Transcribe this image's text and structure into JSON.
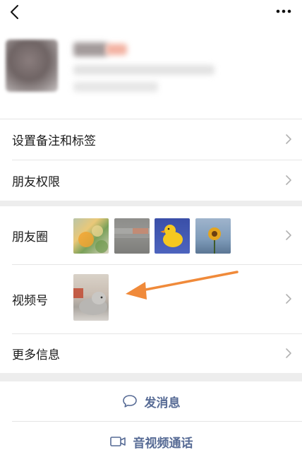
{
  "header": {
    "back_icon": "chevron-left-icon",
    "more_icon": "more-dots-icon"
  },
  "menu": {
    "remark_label": "设置备注和标签",
    "permission_label": "朋友权限",
    "moments_label": "朋友圈",
    "channels_label": "视频号",
    "more_info_label": "更多信息"
  },
  "actions": {
    "message_label": "发消息",
    "call_label": "音视频通话"
  },
  "colors": {
    "link": "#576b95",
    "arrow": "#f08a3a",
    "background": "#ededed"
  }
}
